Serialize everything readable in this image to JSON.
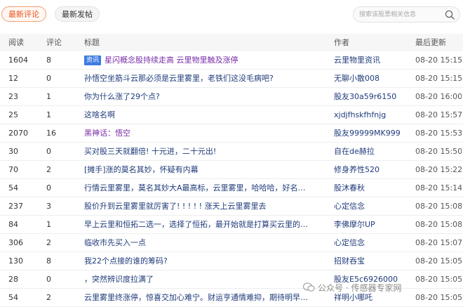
{
  "tabs": {
    "latest_comments": "最新评论",
    "latest_posts": "最新发帖"
  },
  "search": {
    "placeholder": "搜索该股票相关信息"
  },
  "columns": {
    "reads": "阅读",
    "comments": "评论",
    "title": "标题",
    "author": "作者",
    "last_update": "最后更新"
  },
  "rows": [
    {
      "reads": "1604",
      "comments": "8",
      "tag": "资讯",
      "title": "星闪概念股持续走高 云里物里触及涨停",
      "author": "云里物里资讯",
      "time": "08-20 15:15",
      "kind": "news"
    },
    {
      "reads": "12",
      "comments": "0",
      "title": "孙悟空坐筋斗云那必须是云里雾里，老铁们这没毛病吧?",
      "author": "无聊小散008",
      "time": "08-20 15:15"
    },
    {
      "reads": "23",
      "comments": "1",
      "title": "你为什么涨了29个点?",
      "author": "股友30a59r6150",
      "time": "08-20 16:00"
    },
    {
      "reads": "25",
      "comments": "1",
      "title": "这啥名啊",
      "author": "xjdjfhskfhfnjg",
      "time": "08-20 15:57"
    },
    {
      "reads": "2070",
      "comments": "16",
      "title": "黑神话：悟空",
      "author": "股友99999MK999",
      "time": "08-20 15:53",
      "kind": "news"
    },
    {
      "reads": "30",
      "comments": "0",
      "title": "买对股三天就翻倍! 十元进，二十元出!",
      "author": "自在de赫拉",
      "time": "08-20 15:50"
    },
    {
      "reads": "70",
      "comments": "2",
      "title": "[摊手]涨的莫名其妙，怀疑有内幕",
      "author": "修身养性520",
      "time": "08-20 15:22"
    },
    {
      "reads": "54",
      "comments": "0",
      "title": "行情云里雾里，莫名其妙大A最高标，云里雾里，哈哈哈，好名…",
      "author": "股沐春秋",
      "time": "08-20 15:14"
    },
    {
      "reads": "237",
      "comments": "3",
      "title": "股价升到云里雾里就厉害了! ! ! ! ! 涨天上云里雾里去",
      "author": "心定信念",
      "time": "08-20 15:08"
    },
    {
      "reads": "84",
      "comments": "1",
      "title": "早上云里和恒拓二选一，选择了恒拓，最开始就是打算买云里的…",
      "author": "李佛摩尔UP",
      "time": "08-20 15:08"
    },
    {
      "reads": "306",
      "comments": "2",
      "title": "临收市先买入一点",
      "author": "心定信念",
      "time": "08-20 15:07"
    },
    {
      "reads": "130",
      "comments": "8",
      "title": "我22个点接的谁的筹码?",
      "author": "招财吞宝",
      "time": "08-20 15:05"
    },
    {
      "reads": "28",
      "comments": "0",
      "title": "，突然辨识度拉满了",
      "author": "股友E5c6926000",
      "time": "08-20 15:05"
    },
    {
      "reads": "54",
      "comments": "2",
      "title": "云里雾里终涨停，惊喜交加心难宁。财运亨通情难抑，期待明早…",
      "author": "祥明小哪吒",
      "time": "08-20 15:05"
    }
  ],
  "watermark": {
    "text": "公众号 · 传感器专家网"
  },
  "colors": {
    "accent": "#e8561c",
    "link": "#1f3b7a",
    "news_title": "#7a2da8",
    "tag_bg": "#3d7be0"
  }
}
